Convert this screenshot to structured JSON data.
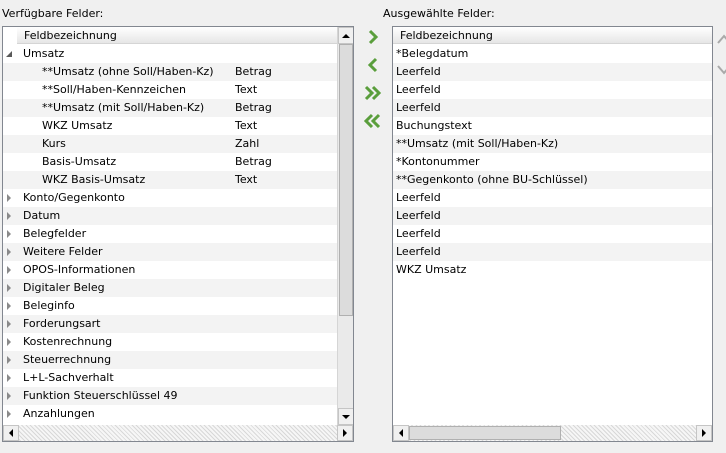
{
  "available": {
    "caption": "Verfügbare Felder:",
    "header": "Feldbezeichnung",
    "rows": [
      {
        "label": "Umsatz",
        "type": "",
        "level": 0,
        "expanded": true
      },
      {
        "label": "**Umsatz (ohne Soll/Haben-Kz)",
        "type": "Betrag",
        "level": 1
      },
      {
        "label": "**Soll/Haben-Kennzeichen",
        "type": "Text",
        "level": 1
      },
      {
        "label": "**Umsatz (mit Soll/Haben-Kz)",
        "type": "Betrag",
        "level": 1
      },
      {
        "label": "WKZ Umsatz",
        "type": "Text",
        "level": 1
      },
      {
        "label": "Kurs",
        "type": "Zahl",
        "level": 1
      },
      {
        "label": "Basis-Umsatz",
        "type": "Betrag",
        "level": 1
      },
      {
        "label": "WKZ Basis-Umsatz",
        "type": "Text",
        "level": 1
      },
      {
        "label": "Konto/Gegenkonto",
        "type": "",
        "level": 0,
        "expanded": false
      },
      {
        "label": "Datum",
        "type": "",
        "level": 0,
        "expanded": false
      },
      {
        "label": "Belegfelder",
        "type": "",
        "level": 0,
        "expanded": false
      },
      {
        "label": "Weitere Felder",
        "type": "",
        "level": 0,
        "expanded": false
      },
      {
        "label": "OPOS-Informationen",
        "type": "",
        "level": 0,
        "expanded": false
      },
      {
        "label": "Digitaler Beleg",
        "type": "",
        "level": 0,
        "expanded": false
      },
      {
        "label": "Beleginfo",
        "type": "",
        "level": 0,
        "expanded": false
      },
      {
        "label": "Forderungsart",
        "type": "",
        "level": 0,
        "expanded": false
      },
      {
        "label": "Kostenrechnung",
        "type": "",
        "level": 0,
        "expanded": false
      },
      {
        "label": "Steuerrechnung",
        "type": "",
        "level": 0,
        "expanded": false
      },
      {
        "label": "L+L-Sachverhalt",
        "type": "",
        "level": 0,
        "expanded": false
      },
      {
        "label": "Funktion Steuerschlüssel 49",
        "type": "",
        "level": 0,
        "expanded": false
      },
      {
        "label": "Anzahlungen",
        "type": "",
        "level": 0,
        "expanded": false
      }
    ]
  },
  "selected": {
    "caption": "Ausgewählte Felder:",
    "header": "Feldbezeichnung",
    "rows": [
      "*Belegdatum",
      "Leerfeld",
      "Leerfeld",
      "Leerfeld",
      "Buchungstext",
      "**Umsatz (mit Soll/Haben-Kz)",
      "*Kontonummer",
      "**Gegenkonto (ohne BU-Schlüssel)",
      "Leerfeld",
      "Leerfeld",
      "Leerfeld",
      "Leerfeld",
      "WKZ Umsatz"
    ]
  },
  "move_buttons": [
    {
      "name": "add-button",
      "icon": "chevron-right-icon",
      "glyph": "›"
    },
    {
      "name": "remove-button",
      "icon": "chevron-left-icon",
      "glyph": "‹"
    },
    {
      "name": "add-all-button",
      "icon": "double-chevron-right-icon",
      "glyph": "»"
    },
    {
      "name": "remove-all-button",
      "icon": "double-chevron-left-icon",
      "glyph": "«"
    }
  ],
  "colors": {
    "arrow_green": "#5a9e3c",
    "arrow_gray": "#a9a9a9"
  }
}
